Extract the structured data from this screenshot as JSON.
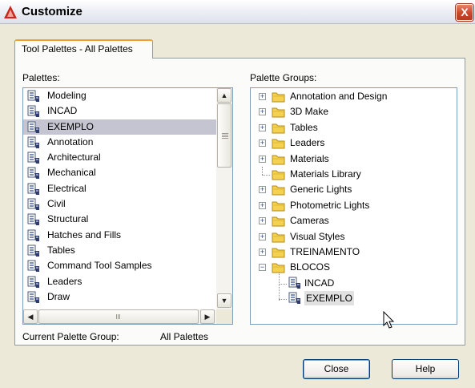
{
  "window": {
    "title": "Customize",
    "close_glyph": "X",
    "icon": "autocad-icon"
  },
  "tabs": [
    {
      "label": "Tool Palettes - All Palettes",
      "active": true
    }
  ],
  "palettes": {
    "label": "Palettes:",
    "items": [
      {
        "label": "Modeling"
      },
      {
        "label": "INCAD"
      },
      {
        "label": "EXEMPLO",
        "selected": true
      },
      {
        "label": "Annotation"
      },
      {
        "label": "Architectural"
      },
      {
        "label": "Mechanical"
      },
      {
        "label": "Electrical"
      },
      {
        "label": "Civil"
      },
      {
        "label": "Structural"
      },
      {
        "label": "Hatches and Fills"
      },
      {
        "label": "Tables"
      },
      {
        "label": "Command Tool Samples"
      },
      {
        "label": "Leaders"
      },
      {
        "label": "Draw"
      }
    ]
  },
  "palette_groups": {
    "label": "Palette Groups:",
    "items": [
      {
        "label": "Annotation and Design",
        "expander": "+"
      },
      {
        "label": "3D Make",
        "expander": "+"
      },
      {
        "label": "Tables",
        "expander": "+"
      },
      {
        "label": "Leaders",
        "expander": "+"
      },
      {
        "label": "Materials",
        "expander": "+"
      },
      {
        "label": "Materials Library",
        "expander": ""
      },
      {
        "label": "Generic Lights",
        "expander": "+"
      },
      {
        "label": "Photometric Lights",
        "expander": "+"
      },
      {
        "label": "Cameras",
        "expander": "+"
      },
      {
        "label": "Visual Styles",
        "expander": "+"
      },
      {
        "label": "TREINAMENTO",
        "expander": "+"
      },
      {
        "label": "BLOCOS",
        "expander": "−"
      }
    ],
    "children": [
      {
        "label": "INCAD"
      },
      {
        "label": "EXEMPLO",
        "selected": true
      }
    ]
  },
  "current_group": {
    "label": "Current Palette Group:",
    "value": "All Palettes"
  },
  "buttons": {
    "close": "Close",
    "help": "Help"
  },
  "colors": {
    "selection": "#c4c5d1",
    "tab_accent": "#f0a030",
    "folder": "#f4d24f",
    "close_red": "#c9472a"
  }
}
